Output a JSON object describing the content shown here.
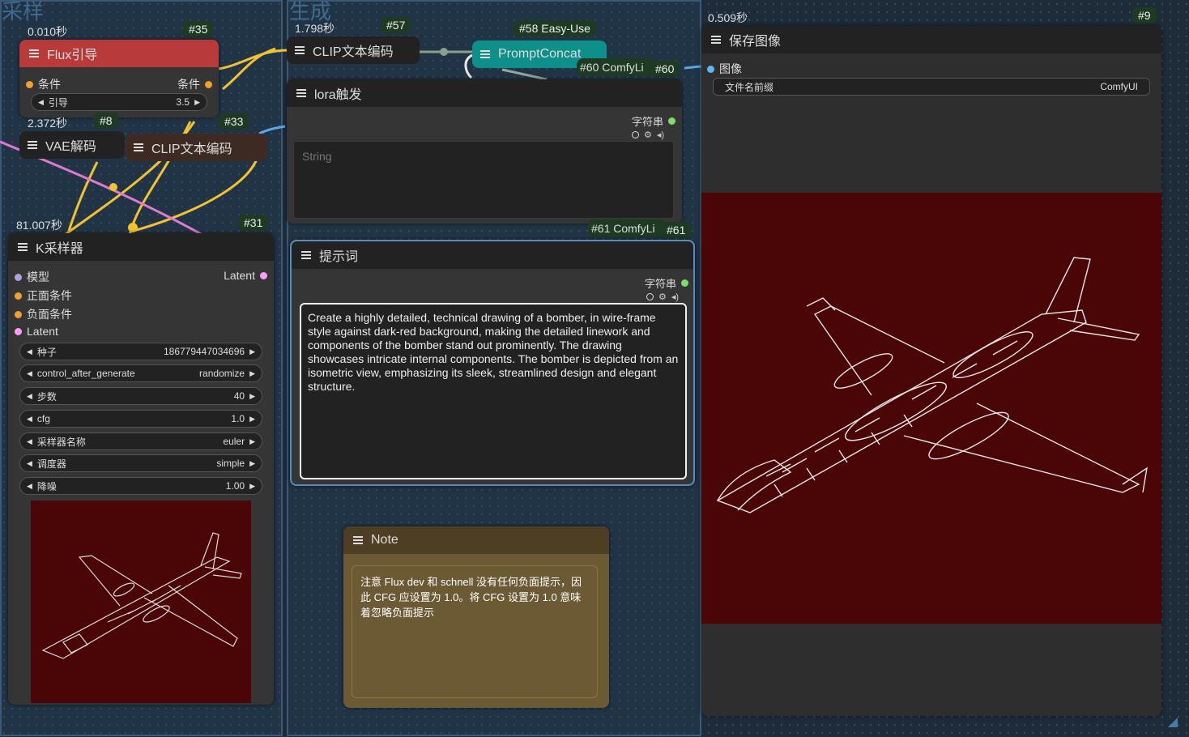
{
  "groups": [
    {
      "title": "采样"
    },
    {
      "title": "生成"
    }
  ],
  "nodes": {
    "flux_guide": {
      "timing": "0.010秒",
      "badge": "#35",
      "title": "Flux引导",
      "in_label": "条件",
      "out_label": "条件",
      "widget_label": "引导",
      "widget_value": "3.5"
    },
    "vae_decode": {
      "timing": "2.372秒",
      "badge": "#8",
      "title": "VAE解码"
    },
    "clip_encode_33": {
      "badge": "#33",
      "title": "CLIP文本编码"
    },
    "ksampler": {
      "timing": "81.007秒",
      "badge": "#31",
      "title": "K采样器",
      "inputs": [
        "模型",
        "正面条件",
        "负面条件",
        "Latent"
      ],
      "output": "Latent",
      "widgets": [
        {
          "label": "种子",
          "value": "186779447034696"
        },
        {
          "label": "control_after_generate",
          "value": "randomize"
        },
        {
          "label": "步数",
          "value": "40"
        },
        {
          "label": "cfg",
          "value": "1.0"
        },
        {
          "label": "采样器名称",
          "value": "euler"
        },
        {
          "label": "调度器",
          "value": "simple"
        },
        {
          "label": "降噪",
          "value": "1.00"
        }
      ]
    },
    "clip_encode_57": {
      "timing": "1.798秒",
      "badge": "#57",
      "title": "CLIP文本编码"
    },
    "prompt_concat": {
      "badge": "#58 Easy-Use",
      "title": "PromptConcat"
    },
    "comfy60": {
      "label": "#60 ComfyLi",
      "badge": "#60"
    },
    "lora_trigger": {
      "title": "lora触发",
      "out_label": "字符串",
      "placeholder": "String"
    },
    "comfy61": {
      "label": "#61 ComfyLi",
      "badge": "#61"
    },
    "prompt": {
      "title": "提示词",
      "out_label": "字符串",
      "text": "Create a highly detailed, technical drawing of a   bomber, in wire-frame style against dark-red background, making the detailed linework and components of the bomber stand out prominently. The drawing showcases intricate internal components. The bomber is depicted from an isometric view, emphasizing its sleek, streamlined design and elegant structure."
    },
    "note": {
      "title": "Note",
      "text": "注意 Flux dev 和 schnell 没有任何负面提示，因此 CFG 应设置为 1.0。将 CFG 设置为 1.0 意味着忽略负面提示"
    },
    "save_image": {
      "timing": "0.509秒",
      "badge": "#9",
      "title": "保存图像",
      "in_label": "图像",
      "widget_label": "文件名前缀",
      "widget_value": "ComfyUI"
    }
  },
  "colors": {
    "flux_title": "#b83a3a",
    "prompt_concat": "#0e8f8a",
    "note_bg": "#5c4c2c",
    "image_bg": "#4a0606",
    "link_yellow": "#f2c230",
    "link_pink": "#e07ad0",
    "link_blue": "#5aa6e6"
  }
}
